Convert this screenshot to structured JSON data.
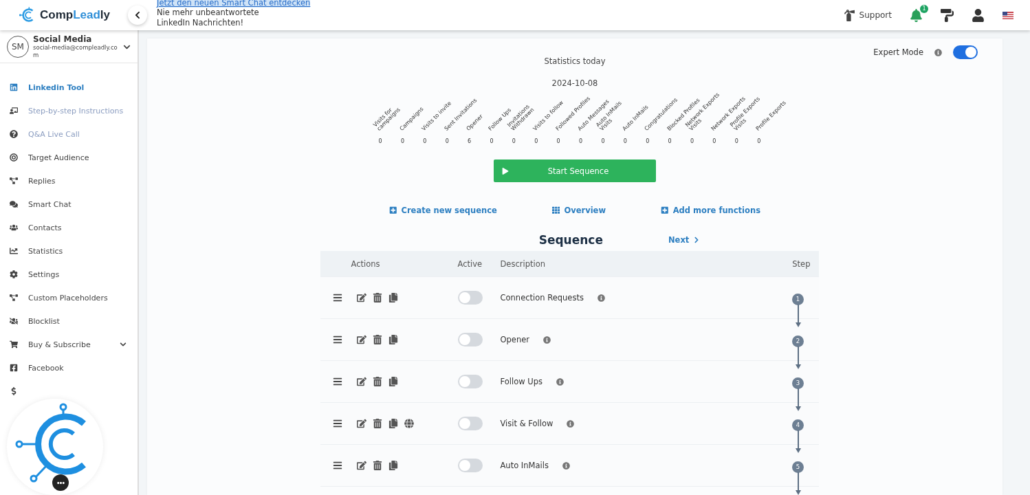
{
  "header": {
    "logo_parts": [
      {
        "text": "Comp",
        "color": "#1f2a36"
      },
      {
        "text": "Lead",
        "color": "#2f8fd8"
      },
      {
        "text": "ly",
        "color": "#1f2a36"
      }
    ],
    "promo_link": "Jetzt den neuen Smart Chat entdecken",
    "promo_text": "Nie mehr unbeantwortete\nLinkedIn Nachrichten!",
    "support": "Support",
    "notification_count": "1"
  },
  "sidebar": {
    "account": {
      "initials": "SM",
      "name": "Social Media",
      "email": "social-media@compleadly.co\nm"
    },
    "items": [
      {
        "label": "Linkedin Tool",
        "selected": true,
        "muted": false,
        "expandable": false
      },
      {
        "label": "Step-by-step Instructions",
        "selected": false,
        "muted": true,
        "expandable": false
      },
      {
        "label": "Q&A Live Call",
        "selected": false,
        "muted": true,
        "expandable": false
      },
      {
        "label": "Target Audience",
        "selected": false,
        "muted": false,
        "expandable": false
      },
      {
        "label": "Replies",
        "selected": false,
        "muted": false,
        "expandable": false
      },
      {
        "label": "Smart Chat",
        "selected": false,
        "muted": false,
        "expandable": false
      },
      {
        "label": "Contacts",
        "selected": false,
        "muted": false,
        "expandable": false
      },
      {
        "label": "Statistics",
        "selected": false,
        "muted": false,
        "expandable": false
      },
      {
        "label": "Settings",
        "selected": false,
        "muted": false,
        "expandable": false
      },
      {
        "label": "Custom Placeholders",
        "selected": false,
        "muted": false,
        "expandable": false
      },
      {
        "label": "Blocklist",
        "selected": false,
        "muted": false,
        "expandable": false
      },
      {
        "label": "Buy & Subscribe",
        "selected": false,
        "muted": false,
        "expandable": true
      },
      {
        "label": "Facebook",
        "selected": false,
        "muted": false,
        "expandable": false
      }
    ]
  },
  "expert_mode": {
    "label": "Expert Mode",
    "on": true
  },
  "stats": {
    "title": "Statistics today",
    "date": "2024-10-08",
    "items": [
      {
        "label": "Visits for\ncampaigns",
        "value": "0"
      },
      {
        "label": "Campaigns",
        "value": "0"
      },
      {
        "label": "Visits to invite",
        "value": "0"
      },
      {
        "label": "Sent Invitations",
        "value": "0"
      },
      {
        "label": "Opener",
        "value": "6"
      },
      {
        "label": "Follow Ups",
        "value": "0"
      },
      {
        "label": "Invitations\nWithdrawn",
        "value": "0"
      },
      {
        "label": "Visits to follow",
        "value": "0"
      },
      {
        "label": "Followed Profiles",
        "value": "0"
      },
      {
        "label": "Auto Messages",
        "value": "0"
      },
      {
        "label": "Auto InMails\nVisits",
        "value": "0"
      },
      {
        "label": "Auto InMails",
        "value": "0"
      },
      {
        "label": "Congratulations",
        "value": "0"
      },
      {
        "label": "Blocked Profiles",
        "value": "0"
      },
      {
        "label": "Network Exports\nVisits",
        "value": "0"
      },
      {
        "label": "Network Exports",
        "value": "0"
      },
      {
        "label": "Profile Exports\nVisits",
        "value": "0"
      },
      {
        "label": "Profile Exports",
        "value": "0"
      }
    ]
  },
  "start_button": "Start Sequence",
  "links": [
    {
      "label": "Create new sequence",
      "kind": "plus"
    },
    {
      "label": "Overview",
      "kind": "grid"
    },
    {
      "label": "Add more functions",
      "kind": "plus"
    }
  ],
  "sequence": {
    "title": "Sequence",
    "next": "Next",
    "columns": [
      "Actions",
      "Active",
      "Description",
      "Step"
    ],
    "rows": [
      {
        "description": "Connection Requests",
        "active": false,
        "step": "1",
        "globe": false
      },
      {
        "description": "Opener",
        "active": false,
        "step": "2",
        "globe": false
      },
      {
        "description": "Follow Ups",
        "active": false,
        "step": "3",
        "globe": false
      },
      {
        "description": "Visit & Follow",
        "active": false,
        "step": "4",
        "globe": true
      },
      {
        "description": "Auto InMails",
        "active": false,
        "step": "5",
        "globe": false
      }
    ]
  }
}
